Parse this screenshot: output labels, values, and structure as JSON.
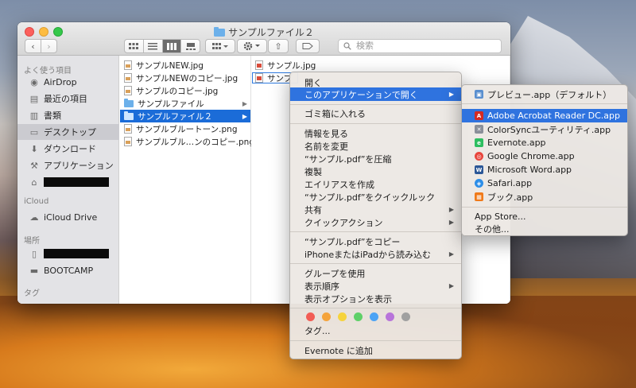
{
  "window": {
    "title": "サンプルファイル２"
  },
  "toolbar": {
    "back_glyph": "‹",
    "forward_glyph": "›",
    "share_glyph": "⇧",
    "search_placeholder": "検索"
  },
  "sidebar": {
    "sections": [
      {
        "heading": "よく使う項目",
        "items": [
          {
            "label": "AirDrop",
            "icon": "airdrop-icon",
            "glyph": "◉"
          },
          {
            "label": "最近の項目",
            "icon": "recents-icon",
            "glyph": "▤"
          },
          {
            "label": "書類",
            "icon": "documents-icon",
            "glyph": "▥"
          },
          {
            "label": "デスクトップ",
            "icon": "desktop-icon",
            "glyph": "▭",
            "selected": true
          },
          {
            "label": "ダウンロード",
            "icon": "downloads-icon",
            "glyph": "⬇"
          },
          {
            "label": "アプリケーション",
            "icon": "applications-icon",
            "glyph": "⚒"
          },
          {
            "label": "",
            "icon": "home-icon",
            "glyph": "⌂",
            "redacted": true
          }
        ]
      },
      {
        "heading": "iCloud",
        "items": [
          {
            "label": "iCloud Drive",
            "icon": "cloud-icon",
            "glyph": "☁"
          }
        ]
      },
      {
        "heading": "場所",
        "items": [
          {
            "label": "",
            "icon": "iphone-icon",
            "glyph": "▯",
            "redacted": true
          },
          {
            "label": "BOOTCAMP",
            "icon": "disk-icon",
            "glyph": "▬"
          }
        ]
      },
      {
        "heading": "タグ",
        "items": []
      }
    ]
  },
  "column1": {
    "items": [
      {
        "name": "サンプルNEW.jpg",
        "kind": "image"
      },
      {
        "name": "サンプルNEWのコピー.jpg",
        "kind": "image"
      },
      {
        "name": "サンプルのコピー.jpg",
        "kind": "image"
      },
      {
        "name": "サンプルファイル",
        "kind": "folder",
        "has_children": true
      },
      {
        "name": "サンプルファイル２",
        "kind": "folder",
        "has_children": true,
        "selected": true
      },
      {
        "name": "サンプルブルートーン.png",
        "kind": "image"
      },
      {
        "name": "サンプルブル…ンのコピー.png",
        "kind": "image"
      }
    ]
  },
  "column2": {
    "items": [
      {
        "name": "サンプル.jpg",
        "kind": "image"
      },
      {
        "name": "サンプ",
        "kind": "pdf",
        "boxed": true
      }
    ]
  },
  "context_menu": {
    "items": [
      {
        "label": "開く"
      },
      {
        "label": "このアプリケーションで開く",
        "submenu": true,
        "highlighted": true
      },
      {
        "separator": true
      },
      {
        "label": "ゴミ箱に入れる"
      },
      {
        "separator": true
      },
      {
        "label": "情報を見る"
      },
      {
        "label": "名前を変更"
      },
      {
        "label": "“サンプル.pdf”を圧縮"
      },
      {
        "label": "複製"
      },
      {
        "label": "エイリアスを作成"
      },
      {
        "label": "“サンプル.pdf”をクイックルック"
      },
      {
        "label": "共有",
        "submenu": true
      },
      {
        "label": "クイックアクション",
        "submenu": true
      },
      {
        "separator": true
      },
      {
        "label": "“サンプル.pdf”をコピー"
      },
      {
        "label": "iPhoneまたはiPadから読み込む",
        "submenu": true
      },
      {
        "separator": true
      },
      {
        "label": "グループを使用"
      },
      {
        "label": "表示順序",
        "submenu": true
      },
      {
        "label": "表示オプションを表示"
      },
      {
        "separator": true
      },
      {
        "tags": true
      },
      {
        "label": "タグ..."
      },
      {
        "separator": true
      },
      {
        "label": "Evernote に追加"
      }
    ],
    "tag_colors": [
      "#f25c54",
      "#f5a33b",
      "#f6d33c",
      "#5fd068",
      "#4ba3f5",
      "#b874da",
      "#a0a0a0"
    ],
    "submenu_arrow": "▶"
  },
  "open_with_submenu": {
    "items": [
      {
        "label": "プレビュー.app（デフォルト）",
        "icon": "preview-icon",
        "color": "#5a8fcf",
        "glyph": "▣"
      },
      {
        "separator": true
      },
      {
        "label": "Adobe Acrobat Reader DC.app",
        "icon": "acrobat-icon",
        "color": "#d42a22",
        "glyph": "A",
        "highlighted": true
      },
      {
        "label": "ColorSyncユーティリティ.app",
        "icon": "colorsync-icon",
        "color": "#8a8f99",
        "glyph": "✕"
      },
      {
        "label": "Evernote.app",
        "icon": "evernote-icon",
        "color": "#2dbe60",
        "glyph": "e"
      },
      {
        "label": "Google Chrome.app",
        "icon": "chrome-icon",
        "color": "#e8453c",
        "glyph": "◎"
      },
      {
        "label": "Microsoft Word.app",
        "icon": "word-icon",
        "color": "#2b5797",
        "glyph": "W"
      },
      {
        "label": "Safari.app",
        "icon": "safari-icon",
        "color": "#2d8ee8",
        "glyph": "◈"
      },
      {
        "label": "ブック.app",
        "icon": "books-icon",
        "color": "#f07a1a",
        "glyph": "▦"
      },
      {
        "separator": true
      },
      {
        "label": "App Store..."
      },
      {
        "label": "その他..."
      }
    ]
  }
}
